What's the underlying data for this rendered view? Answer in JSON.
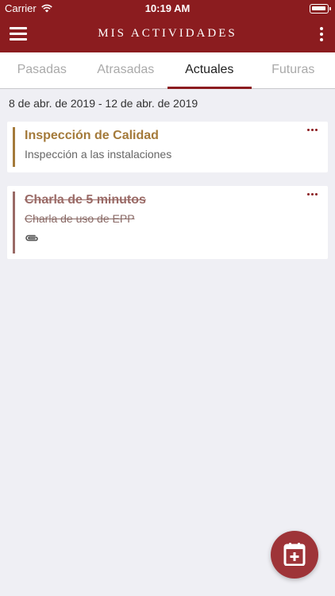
{
  "status_bar": {
    "carrier": "Carrier",
    "time": "10:19 AM"
  },
  "nav": {
    "title": "MIS ACTIVIDADES",
    "menu_icon": "hamburger-menu-icon",
    "more_icon": "vertical-ellipsis-icon"
  },
  "tabs": [
    {
      "label": "Pasadas",
      "active": false
    },
    {
      "label": "Atrasadas",
      "active": false
    },
    {
      "label": "Actuales",
      "active": true
    },
    {
      "label": "Futuras",
      "active": false
    }
  ],
  "date_range": "8 de abr. de 2019 - 12 de abr. de 2019",
  "activities": [
    {
      "title": "Inspección de Calidad",
      "subtitle": "Inspección a las instalaciones",
      "completed": false,
      "has_attachment": false
    },
    {
      "title": "Charla de 5 minutos",
      "subtitle": "Charla de uso de EPP",
      "completed": true,
      "has_attachment": true
    }
  ],
  "fab": {
    "icon": "add-calendar-icon"
  },
  "colors": {
    "primary": "#8b1c1f",
    "pending_accent": "#a47a3a",
    "completed_accent": "#9a6a66",
    "background": "#efeff4"
  }
}
